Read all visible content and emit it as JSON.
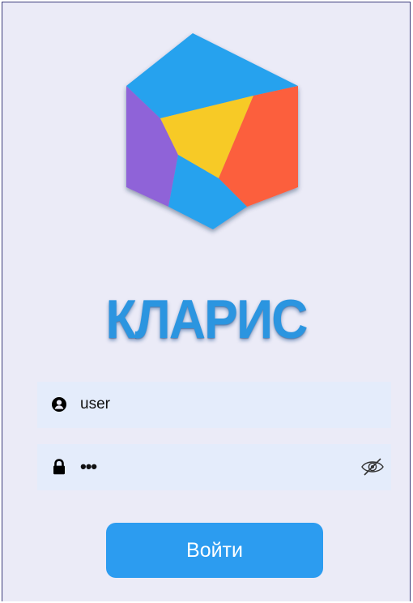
{
  "app": {
    "brand": "КЛАРИС",
    "logo_icon": "hexagon-logo-icon",
    "accent_color": "#2b95e0"
  },
  "form": {
    "login": {
      "icon": "user-icon",
      "value": "user"
    },
    "password": {
      "icon": "lock-icon",
      "value": "•••",
      "toggle_icon": "eye-slash-icon"
    },
    "submit_label": "Войти",
    "submit_color": "#2c9cf0"
  }
}
